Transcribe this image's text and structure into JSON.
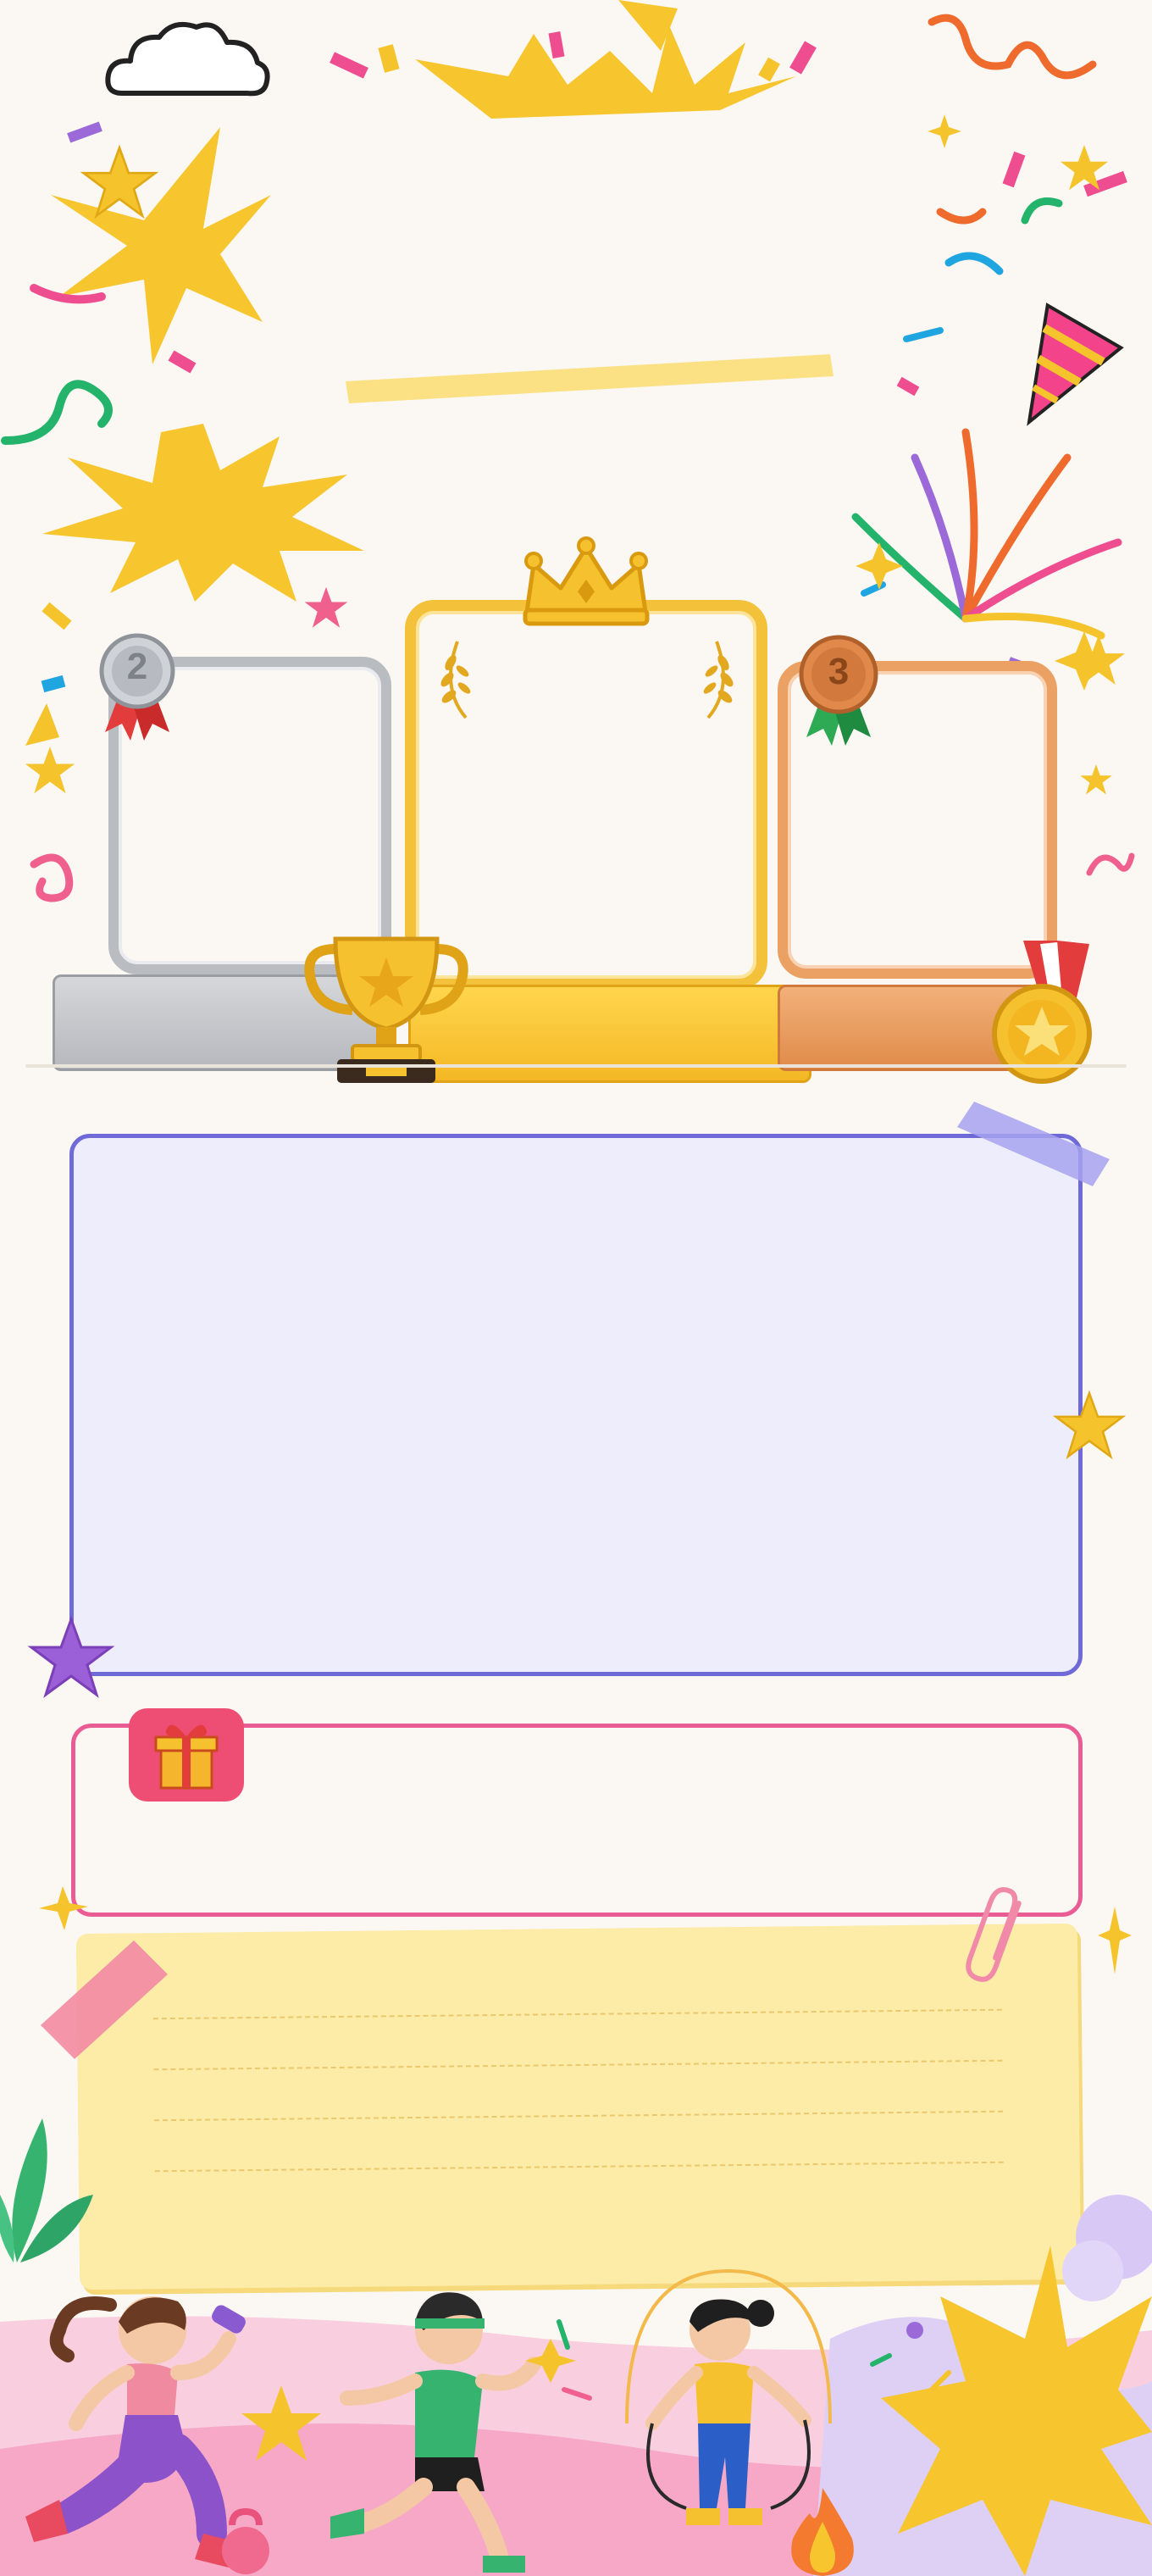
{
  "podium": {
    "second_place_number": "2",
    "third_place_number": "3"
  },
  "colors": {
    "background": "#fbf8f3",
    "gold": "#f4c23a",
    "silver": "#b9bcc1",
    "bronze": "#eba064",
    "main_panel_border": "#6f6ad8",
    "main_panel_fill": "#eeedfb",
    "reward_panel_border": "#ea5d94",
    "note_fill": "#fdeba8"
  },
  "icons": {
    "title_banner": "yellow-brush-stroke",
    "gift": "gift-icon",
    "trophy": "trophy-icon",
    "crown": "crown-icon",
    "party_popper": "party-popper-icon"
  }
}
